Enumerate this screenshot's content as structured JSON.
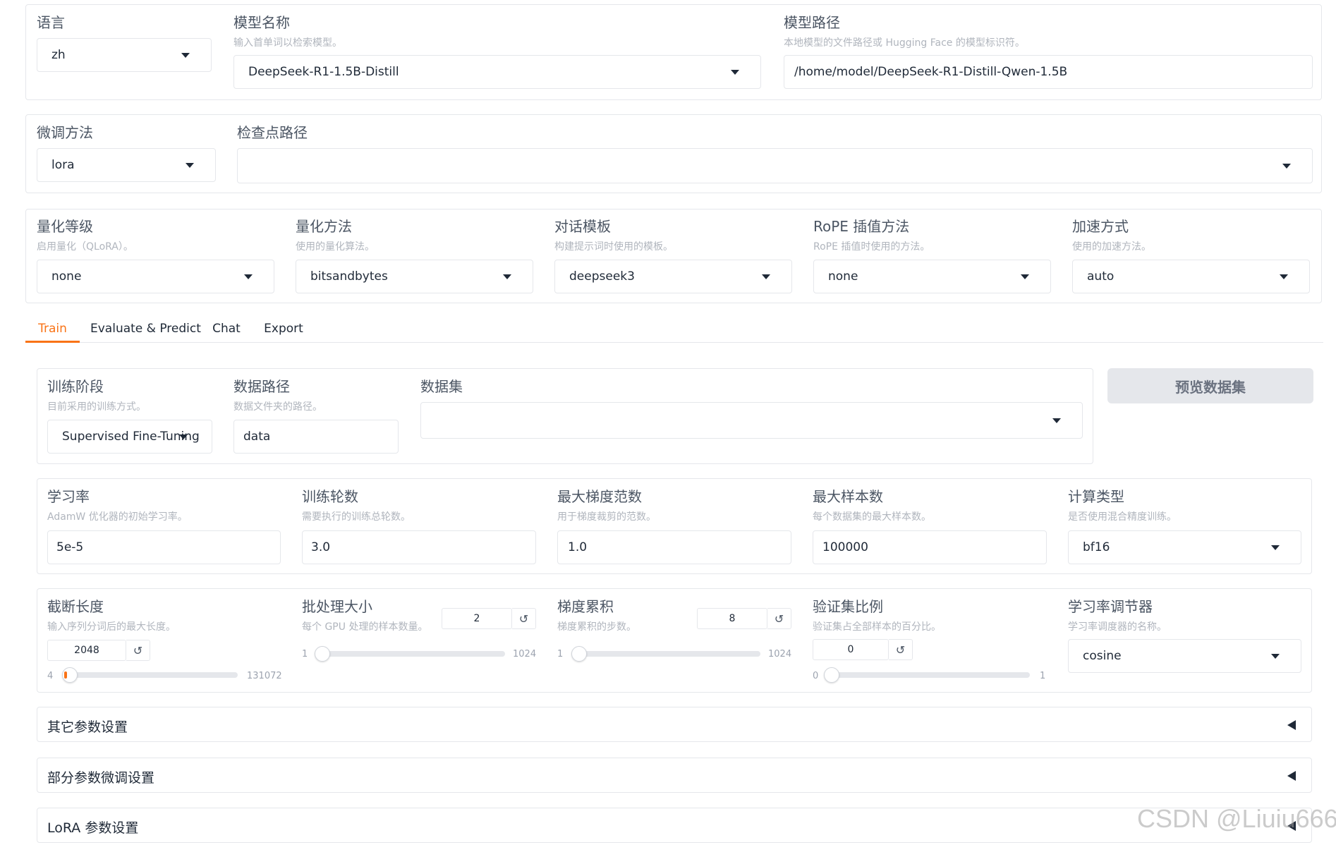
{
  "top": {
    "language": {
      "label": "语言",
      "value": "zh"
    },
    "model_name": {
      "label": "模型名称",
      "info": "输入首单词以检索模型。",
      "value": "DeepSeek-R1-1.5B-Distill"
    },
    "model_path": {
      "label": "模型路径",
      "info": "本地模型的文件路径或 Hugging Face 的模型标识符。",
      "value": "/home/model/DeepSeek-R1-Distill-Qwen-1.5B"
    }
  },
  "finetune": {
    "method": {
      "label": "微调方法",
      "value": "lora"
    },
    "checkpoint": {
      "label": "检查点路径",
      "value": ""
    }
  },
  "advanced": {
    "quant_bit": {
      "label": "量化等级",
      "info": "启用量化（QLoRA）。",
      "value": "none"
    },
    "quant_method": {
      "label": "量化方法",
      "info": "使用的量化算法。",
      "value": "bitsandbytes"
    },
    "template": {
      "label": "对话模板",
      "info": "构建提示词时使用的模板。",
      "value": "deepseek3"
    },
    "rope": {
      "label": "RoPE 插值方法",
      "info": "RoPE 插值时使用的方法。",
      "value": "none"
    },
    "booster": {
      "label": "加速方式",
      "info": "使用的加速方法。",
      "value": "auto"
    }
  },
  "tabs": [
    "Train",
    "Evaluate & Predict",
    "Chat",
    "Export"
  ],
  "train": {
    "stage": {
      "label": "训练阶段",
      "info": "目前采用的训练方式。",
      "value": "Supervised Fine-Tuning"
    },
    "dataset_dir": {
      "label": "数据路径",
      "info": "数据文件夹的路径。",
      "value": "data"
    },
    "dataset": {
      "label": "数据集",
      "value": ""
    },
    "preview_button": "预览数据集",
    "learning_rate": {
      "label": "学习率",
      "info": "AdamW 优化器的初始学习率。",
      "value": "5e-5"
    },
    "epochs": {
      "label": "训练轮数",
      "info": "需要执行的训练总轮数。",
      "value": "3.0"
    },
    "max_grad_norm": {
      "label": "最大梯度范数",
      "info": "用于梯度裁剪的范数。",
      "value": "1.0"
    },
    "max_samples": {
      "label": "最大样本数",
      "info": "每个数据集的最大样本数。",
      "value": "100000"
    },
    "compute_type": {
      "label": "计算类型",
      "info": "是否使用混合精度训练。",
      "value": "bf16"
    },
    "cutoff_len": {
      "label": "截断长度",
      "info": "输入序列分词后的最大长度。",
      "value": "2048",
      "min": "4",
      "max": "131072",
      "fraction": 0.015
    },
    "batch_size": {
      "label": "批处理大小",
      "info": "每个 GPU 处理的样本数量。",
      "value": "2",
      "min": "1",
      "max": "1024",
      "fraction": 0.001
    },
    "grad_accum": {
      "label": "梯度累积",
      "info": "梯度累积的步数。",
      "value": "8",
      "min": "1",
      "max": "1024",
      "fraction": 0.007
    },
    "val_size": {
      "label": "验证集比例",
      "info": "验证集占全部样本的百分比。",
      "value": "0",
      "min": "0",
      "max": "1",
      "fraction": 0.0
    },
    "lr_scheduler": {
      "label": "学习率调节器",
      "info": "学习率调度器的名称。",
      "value": "cosine"
    },
    "reset_icon": "↺"
  },
  "accordions": [
    "其它参数设置",
    "部分参数微调设置",
    "LoRA 参数设置"
  ],
  "watermark": "CSDN @Liuiu666",
  "colors": {
    "accent": "#f97316",
    "border": "#e5e7eb",
    "button_bg": "#e5e7eb"
  }
}
